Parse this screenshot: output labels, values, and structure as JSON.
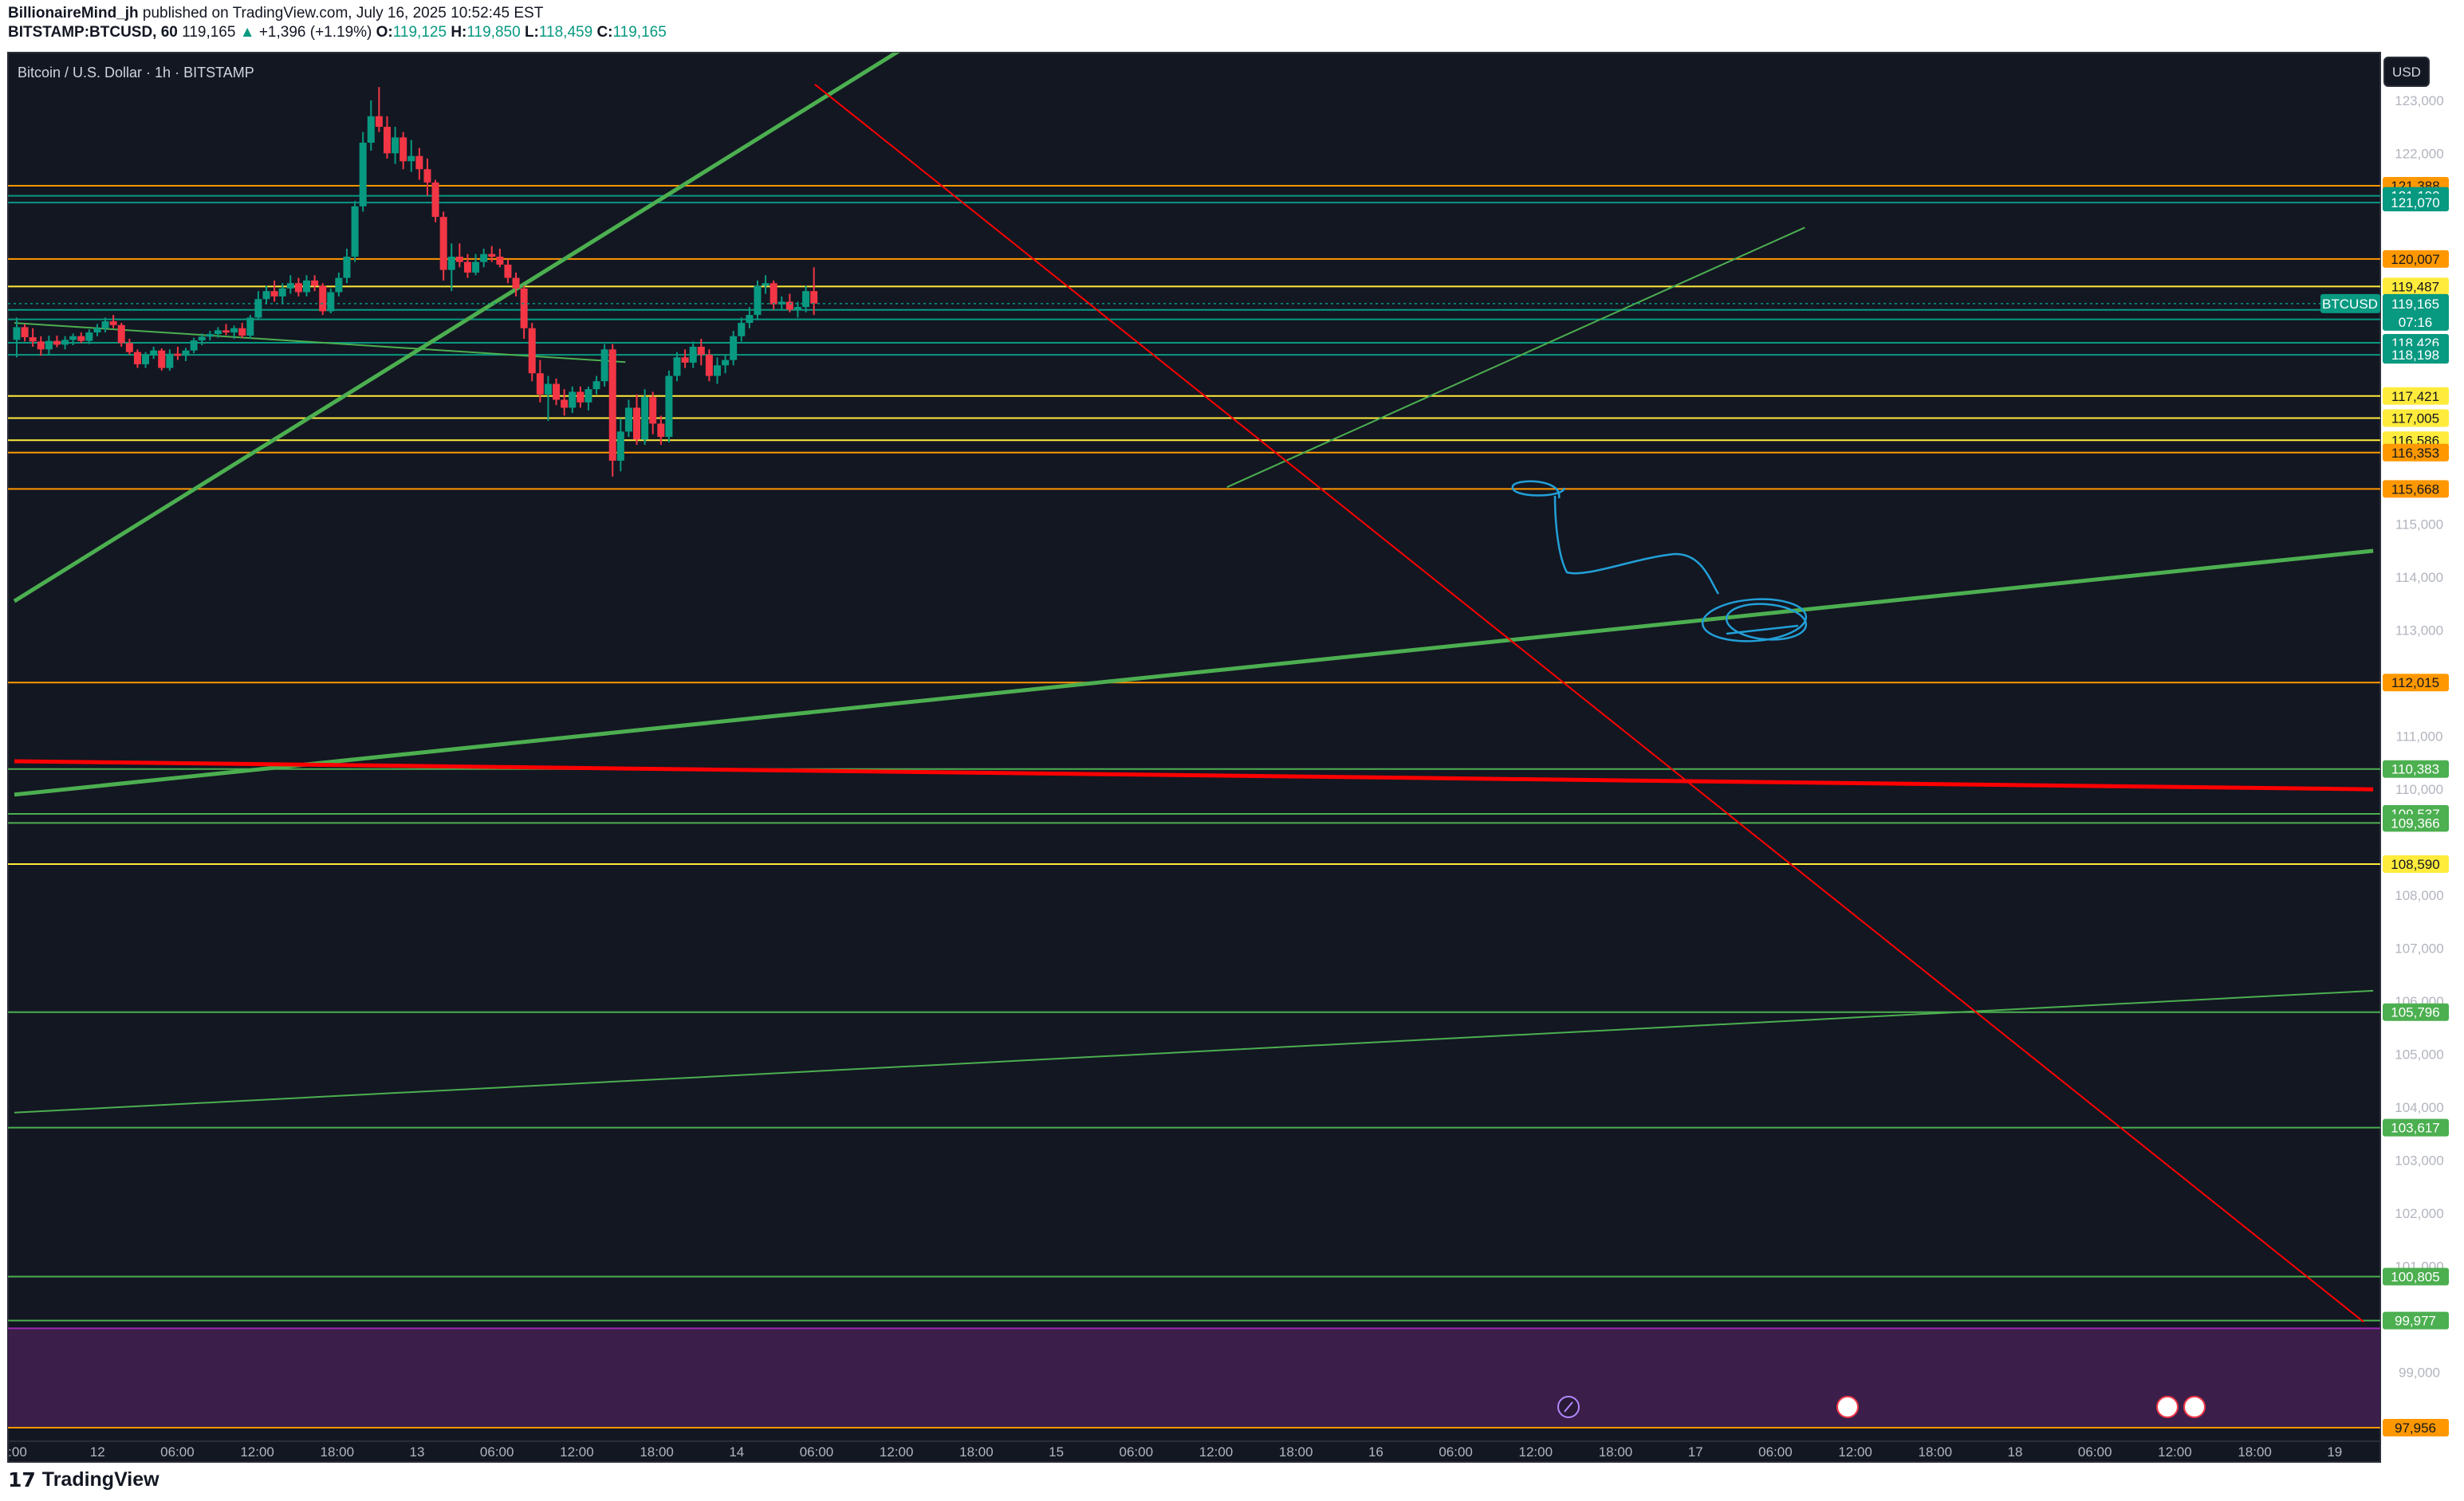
{
  "header": {
    "author": "BillionaireMind_jh",
    "published_text": "published on TradingView.com, July 16, 2025 10:52:45 EST",
    "symbol": "BITSTAMP:BTCUSD, 60",
    "last": "119,165",
    "change": "+1,396 (+1.19%)",
    "o_label": "O:",
    "o_value": "119,125",
    "h_label": "H:",
    "h_value": "119,850",
    "l_label": "L:",
    "l_value": "118,459",
    "c_label": "C:",
    "c_value": "119,165"
  },
  "legend": {
    "title": "Bitcoin / U.S. Dollar · 1h · BITSTAMP"
  },
  "currency_button": "USD",
  "colors": {
    "background": "#131722",
    "up": "#089981",
    "down": "#f23645",
    "orange": "#ff9800",
    "yellow": "#ffeb3b",
    "green": "#4caf50",
    "teal": "#089981",
    "blue_pen": "#22a0d8",
    "purple_zone": "#3b1f4a"
  },
  "footer": {
    "logo_mark": "17",
    "brand": "TradingView"
  },
  "chart_data": {
    "type": "candlestick",
    "x_axis_labels": [
      ":00",
      "12",
      "06:00",
      "12:00",
      "18:00",
      "13",
      "06:00",
      "12:00",
      "18:00",
      "14",
      "06:00",
      "12:00",
      "18:00",
      "15",
      "06:00",
      "12:00",
      "18:00",
      "16",
      "06:00",
      "12:00",
      "18:00",
      "17",
      "06:00",
      "12:00",
      "18:00",
      "18",
      "06:00",
      "12:00",
      "18:00",
      "19"
    ],
    "y_axis_ticks": [
      "123,000",
      "122,000",
      "115,000",
      "114,000",
      "113,000",
      "111,000",
      "110,000",
      "108,000",
      "107,000",
      "106,000",
      "105,000",
      "104,000",
      "103,000",
      "102,000",
      "101,000",
      "99,000"
    ],
    "y_range": [
      97700,
      123900
    ],
    "current_price": {
      "symbol": "BTCUSD",
      "value": "119,165",
      "countdown": "07:16"
    },
    "price_levels": [
      {
        "value": 121388,
        "label": "121,388",
        "color": "orange"
      },
      {
        "value": 121199,
        "label": "121,199",
        "color": "teal"
      },
      {
        "value": 121070,
        "label": "121,070",
        "color": "teal"
      },
      {
        "value": 120007,
        "label": "120,007",
        "color": "orange"
      },
      {
        "value": 119487,
        "label": "119,487",
        "color": "yellow"
      },
      {
        "value": 119045,
        "label": "119,045",
        "color": "teal"
      },
      {
        "value": 118867,
        "label": "118,867",
        "color": "teal"
      },
      {
        "value": 118426,
        "label": "118,426",
        "color": "teal"
      },
      {
        "value": 118198,
        "label": "118,198",
        "color": "teal"
      },
      {
        "value": 117421,
        "label": "117,421",
        "color": "yellow"
      },
      {
        "value": 117005,
        "label": "117,005",
        "color": "yellow"
      },
      {
        "value": 116586,
        "label": "116,586",
        "color": "yellow"
      },
      {
        "value": 116353,
        "label": "116,353",
        "color": "orange"
      },
      {
        "value": 115668,
        "label": "115,668",
        "color": "orange"
      },
      {
        "value": 112015,
        "label": "112,015",
        "color": "orange"
      },
      {
        "value": 110383,
        "label": "110,383",
        "color": "green"
      },
      {
        "value": 109537,
        "label": "109,537",
        "color": "green"
      },
      {
        "value": 109366,
        "label": "109,366",
        "color": "green"
      },
      {
        "value": 108590,
        "label": "108,590",
        "color": "yellow"
      },
      {
        "value": 105796,
        "label": "105,796",
        "color": "green"
      },
      {
        "value": 103617,
        "label": "103,617",
        "color": "green"
      },
      {
        "value": 100805,
        "label": "100,805",
        "color": "green"
      },
      {
        "value": 99977,
        "label": "99,977",
        "color": "green"
      },
      {
        "value": 97956,
        "label": "97,956",
        "color": "orange"
      }
    ],
    "zone": {
      "from": 97956,
      "to": 99830,
      "color": "purple_zone"
    },
    "trendlines": [
      {
        "color": "green",
        "width": 5,
        "from": {
          "t": 0,
          "p": 113550
        },
        "to": {
          "t": 188,
          "p": 124000
        }
      },
      {
        "color": "green",
        "width": 5,
        "from": {
          "t": 0,
          "p": 109900
        },
        "to": {
          "t": 498,
          "p": 114500
        }
      },
      {
        "color": "green",
        "width": 2,
        "from": {
          "t": 0,
          "p": 103900
        },
        "to": {
          "t": 498,
          "p": 106200
        }
      },
      {
        "color": "green",
        "width": 2,
        "from": {
          "t": 0,
          "p": 118800
        },
        "to": {
          "t": 129,
          "p": 118060
        }
      },
      {
        "color": "green",
        "width": 2,
        "from": {
          "t": 256,
          "p": 115700
        },
        "to": {
          "t": 378,
          "p": 120600
        }
      },
      {
        "color": "red",
        "width": 5,
        "from": {
          "t": 0,
          "p": 110530
        },
        "to": {
          "t": 498,
          "p": 110000
        }
      },
      {
        "color": "red",
        "width": 2,
        "from": {
          "t": 169,
          "p": 123300
        },
        "to": {
          "t": 496,
          "p": 99950
        }
      }
    ],
    "candles": [
      [
        118480,
        118900,
        118150,
        118720
      ],
      [
        118720,
        118780,
        118450,
        118530
      ],
      [
        118530,
        118700,
        118350,
        118450
      ],
      [
        118450,
        118550,
        118180,
        118300
      ],
      [
        118300,
        118560,
        118200,
        118460
      ],
      [
        118460,
        118560,
        118340,
        118390
      ],
      [
        118390,
        118550,
        118300,
        118480
      ],
      [
        118480,
        118600,
        118380,
        118550
      ],
      [
        118550,
        118620,
        118420,
        118460
      ],
      [
        118460,
        118680,
        118400,
        118620
      ],
      [
        118620,
        118780,
        118550,
        118700
      ],
      [
        118700,
        118900,
        118620,
        118830
      ],
      [
        118830,
        118950,
        118700,
        118760
      ],
      [
        118760,
        118800,
        118350,
        118420
      ],
      [
        118420,
        118500,
        118200,
        118250
      ],
      [
        118250,
        118300,
        117950,
        118020
      ],
      [
        118020,
        118250,
        117950,
        118200
      ],
      [
        118200,
        118350,
        118120,
        118280
      ],
      [
        118280,
        118320,
        117900,
        117950
      ],
      [
        117950,
        118300,
        117900,
        118220
      ],
      [
        118220,
        118350,
        118100,
        118180
      ],
      [
        118180,
        118330,
        118080,
        118280
      ],
      [
        118280,
        118520,
        118230,
        118470
      ],
      [
        118470,
        118600,
        118380,
        118540
      ],
      [
        118540,
        118650,
        118470,
        118590
      ],
      [
        118590,
        118720,
        118520,
        118660
      ],
      [
        118660,
        118780,
        118570,
        118620
      ],
      [
        118620,
        118750,
        118500,
        118700
      ],
      [
        118700,
        118800,
        118520,
        118560
      ],
      [
        118560,
        118950,
        118500,
        118900
      ],
      [
        118900,
        119400,
        118850,
        119250
      ],
      [
        119250,
        119500,
        119150,
        119400
      ],
      [
        119400,
        119600,
        119200,
        119300
      ],
      [
        119300,
        119550,
        119150,
        119450
      ],
      [
        119450,
        119700,
        119350,
        119550
      ],
      [
        119550,
        119650,
        119300,
        119380
      ],
      [
        119380,
        119700,
        119300,
        119600
      ],
      [
        119600,
        119700,
        119400,
        119500
      ],
      [
        119500,
        119550,
        118950,
        119020
      ],
      [
        119020,
        119450,
        118980,
        119380
      ],
      [
        119380,
        119750,
        119300,
        119650
      ],
      [
        119650,
        120200,
        119550,
        120050
      ],
      [
        120050,
        121100,
        119950,
        121000
      ],
      [
        121000,
        122400,
        120900,
        122200
      ],
      [
        122200,
        123000,
        122050,
        122700
      ],
      [
        122700,
        123250,
        122400,
        122500
      ],
      [
        122500,
        122700,
        121900,
        122000
      ],
      [
        122000,
        122500,
        121800,
        122300
      ],
      [
        122300,
        122400,
        121700,
        121850
      ],
      [
        121850,
        122250,
        121650,
        121950
      ],
      [
        121950,
        122100,
        121500,
        121700
      ],
      [
        121700,
        121900,
        121200,
        121450
      ],
      [
        121450,
        121500,
        120700,
        120800
      ],
      [
        120800,
        120900,
        119600,
        119800
      ],
      [
        119800,
        120300,
        119400,
        120050
      ],
      [
        120050,
        120300,
        119850,
        119950
      ],
      [
        119950,
        120100,
        119650,
        119750
      ],
      [
        119750,
        120100,
        119700,
        119950
      ],
      [
        119950,
        120200,
        119850,
        120100
      ],
      [
        120100,
        120250,
        119950,
        120050
      ],
      [
        120050,
        120200,
        119850,
        119900
      ],
      [
        119900,
        120000,
        119550,
        119650
      ],
      [
        119650,
        119750,
        119300,
        119450
      ],
      [
        119450,
        119500,
        118500,
        118700
      ],
      [
        118700,
        118800,
        117700,
        117850
      ],
      [
        117850,
        118100,
        117300,
        117450
      ],
      [
        117450,
        117800,
        116950,
        117650
      ],
      [
        117650,
        117750,
        117250,
        117350
      ],
      [
        117350,
        117550,
        117050,
        117200
      ],
      [
        117200,
        117600,
        117100,
        117500
      ],
      [
        117500,
        117600,
        117200,
        117300
      ],
      [
        117300,
        117600,
        117150,
        117550
      ],
      [
        117550,
        117800,
        117450,
        117700
      ],
      [
        117700,
        118400,
        117600,
        118300
      ],
      [
        118300,
        118400,
        115900,
        116200
      ],
      [
        116200,
        117000,
        116000,
        116750
      ],
      [
        116750,
        117350,
        116650,
        117200
      ],
      [
        117200,
        117450,
        116500,
        116600
      ],
      [
        116600,
        117550,
        116500,
        117400
      ],
      [
        117400,
        117500,
        116700,
        116900
      ],
      [
        116900,
        117050,
        116500,
        116650
      ],
      [
        116650,
        117900,
        116550,
        117800
      ],
      [
        117800,
        118250,
        117700,
        118150
      ],
      [
        118150,
        118300,
        117950,
        118050
      ],
      [
        118050,
        118450,
        117950,
        118350
      ],
      [
        118350,
        118500,
        118000,
        118200
      ],
      [
        118200,
        118300,
        117700,
        117800
      ],
      [
        117800,
        118150,
        117650,
        118000
      ],
      [
        118000,
        118200,
        117850,
        118100
      ],
      [
        118100,
        118650,
        118000,
        118550
      ],
      [
        118550,
        118900,
        118450,
        118800
      ],
      [
        118800,
        119100,
        118700,
        118950
      ],
      [
        118950,
        119600,
        118850,
        119500
      ],
      [
        119500,
        119700,
        119350,
        119550
      ],
      [
        119550,
        119600,
        119050,
        119150
      ],
      [
        119150,
        119300,
        119050,
        119200
      ],
      [
        119200,
        119350,
        119000,
        119050
      ],
      [
        119050,
        119200,
        118900,
        119100
      ],
      [
        119100,
        119500,
        119000,
        119400
      ],
      [
        119400,
        119850,
        118950,
        119165
      ]
    ]
  }
}
